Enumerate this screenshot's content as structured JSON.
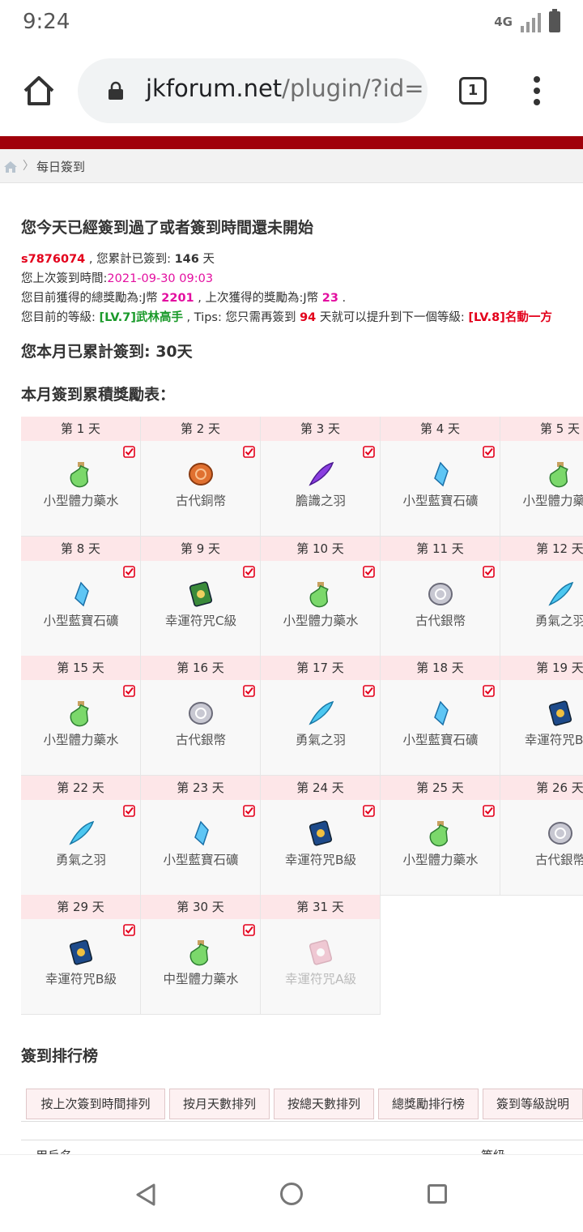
{
  "status_bar": {
    "time": "9:24",
    "network": "4G"
  },
  "browser": {
    "url_domain": "jkforum.net",
    "url_path": "/plugin/?id=",
    "tab_count": "1"
  },
  "breadcrumb": {
    "label": "每日簽到"
  },
  "signin": {
    "heading": "您今天已經簽到過了或者簽到時間還未開始",
    "username": "s7876074",
    "total_prefix": " , 您累計已簽到: ",
    "total_days": "146",
    "days_unit": " 天",
    "last_label": "您上次簽到時間:",
    "last_time": "2021-09-30 09:03",
    "reward_prefix": "您目前獲得的總獎勵為:J幣 ",
    "total_reward": "2201",
    "last_reward_prefix": " , 上次獲得的獎勵為:J幣 ",
    "last_reward": "23",
    "period": " .",
    "level_prefix": "您目前的等級: ",
    "current_level": "[LV.7]武林高手",
    "tips_prefix": " , Tips: 您只需再簽到 ",
    "days_needed": "94",
    "tips_suffix": " 天就可以提升到下一個等級: ",
    "next_level": "[LV.8]名動一方",
    "month_total": "您本月已累計簽到: 30天",
    "reward_table_title": "本月簽到累積獎勵表："
  },
  "reward_grid": [
    {
      "day": "第 1 天",
      "item": "小型體力藥水",
      "icon": "potion-icon",
      "checked": true
    },
    {
      "day": "第 2 天",
      "item": "古代銅幣",
      "icon": "copper-coin-icon",
      "checked": true
    },
    {
      "day": "第 3 天",
      "item": "膽識之羽",
      "icon": "purple-feather-icon",
      "checked": true
    },
    {
      "day": "第 4 天",
      "item": "小型藍寶石礦",
      "icon": "sapphire-icon",
      "checked": true
    },
    {
      "day": "第 5 天",
      "item": "小型體力藥水",
      "icon": "potion-icon",
      "checked": true
    },
    {
      "day": "第 8 天",
      "item": "小型藍寶石礦",
      "icon": "sapphire-icon",
      "checked": true
    },
    {
      "day": "第 9 天",
      "item": "幸運符咒C級",
      "icon": "charm-c-icon",
      "checked": true
    },
    {
      "day": "第 10 天",
      "item": "小型體力藥水",
      "icon": "potion-icon",
      "checked": true
    },
    {
      "day": "第 11 天",
      "item": "古代銀幣",
      "icon": "silver-coin-icon",
      "checked": true
    },
    {
      "day": "第 12 天",
      "item": "勇氣之羽",
      "icon": "blue-feather-icon",
      "checked": true
    },
    {
      "day": "第 15 天",
      "item": "小型體力藥水",
      "icon": "potion-icon",
      "checked": true
    },
    {
      "day": "第 16 天",
      "item": "古代銀幣",
      "icon": "silver-coin-icon",
      "checked": true
    },
    {
      "day": "第 17 天",
      "item": "勇氣之羽",
      "icon": "blue-feather-icon",
      "checked": true
    },
    {
      "day": "第 18 天",
      "item": "小型藍寶石礦",
      "icon": "sapphire-icon",
      "checked": true
    },
    {
      "day": "第 19 天",
      "item": "幸運符咒B級",
      "icon": "charm-b-icon",
      "checked": true
    },
    {
      "day": "第 22 天",
      "item": "勇氣之羽",
      "icon": "blue-feather-icon",
      "checked": true
    },
    {
      "day": "第 23 天",
      "item": "小型藍寶石礦",
      "icon": "sapphire-icon",
      "checked": true
    },
    {
      "day": "第 24 天",
      "item": "幸運符咒B級",
      "icon": "charm-b-icon",
      "checked": true
    },
    {
      "day": "第 25 天",
      "item": "小型體力藥水",
      "icon": "potion-icon",
      "checked": true
    },
    {
      "day": "第 26 天",
      "item": "古代銀幣",
      "icon": "silver-coin-icon",
      "checked": true
    },
    {
      "day": "第 29 天",
      "item": "幸運符咒B級",
      "icon": "charm-b-icon",
      "checked": true
    },
    {
      "day": "第 30 天",
      "item": "中型體力藥水",
      "icon": "potion-icon",
      "checked": true
    },
    {
      "day": "第 31 天",
      "item": "幸運符咒A級",
      "icon": "charm-a-icon",
      "checked": false
    }
  ],
  "ranking": {
    "title": "簽到排行榜",
    "tabs": [
      "按上次簽到時間排列",
      "按月天數排列",
      "按總天數排列",
      "總獎勵排行榜",
      "簽到等級說明"
    ],
    "header_user": "用戶名",
    "header_level": "等級"
  },
  "colors": {
    "brand_red": "#a0000a",
    "username_red": "#e3001b",
    "time_magenta": "#e30fa0",
    "level_green": "#1a9a2a"
  }
}
